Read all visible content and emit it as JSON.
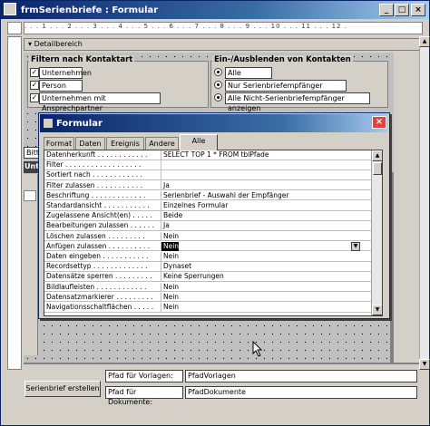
{
  "window": {
    "title": "frmSerienbriefe : Formular"
  },
  "ruler_text": ". . . 1 . . . 2 . . . 3 . . . 4 . . . 5 . . . 6 . . . 7 . . . 8 . . . 9 . . . 10 . . . 11 . . . 12 .",
  "section": {
    "label": "Detailbereich"
  },
  "filter_group": {
    "title": "Filtern nach Kontaktart",
    "items": [
      {
        "label": "Unternehmen",
        "checked": "✓"
      },
      {
        "label": "Person",
        "checked": "✓"
      },
      {
        "label": "Unternehmen mit Ansprechpartner",
        "checked": "✓"
      }
    ]
  },
  "visibility_group": {
    "title": "Ein-/Ausblenden von Kontakten",
    "options": [
      {
        "label": "Alle anzeigen"
      },
      {
        "label": "Nur Serienbriefempfänger anzeigen"
      },
      {
        "label": "Alle Nicht-Serienbriefempfänger anzeigen"
      }
    ]
  },
  "partial_labels": {
    "bitte": "Bitt",
    "unt": "Unt"
  },
  "dialog": {
    "title": "Formular",
    "tabs": [
      "Format",
      "Daten",
      "Ereignis",
      "Andere",
      "Alle"
    ],
    "properties": [
      {
        "name": "Datenherkunft . . . . . . . . . . . .",
        "value": "SELECT TOP 1 * FROM tblPfade"
      },
      {
        "name": "Filter . . . . . . . . . . . . . . . . . .",
        "value": ""
      },
      {
        "name": "Sortiert nach . . . . . . . . . . . .",
        "value": ""
      },
      {
        "name": "Filter zulassen . . . . . . . . . . .",
        "value": "Ja"
      },
      {
        "name": "Beschriftung . . . . . . . . . . . . .",
        "value": "Serienbrief - Auswahl der Empfänger"
      },
      {
        "name": "Standardansicht . . . . . . . . . . .",
        "value": "Einzelnes Formular"
      },
      {
        "name": "Zugelassene Ansicht(en) . . . . .",
        "value": "Beide"
      },
      {
        "name": "Bearbeitungen zulassen . . . . . .",
        "value": "Ja"
      },
      {
        "name": "Löschen zulassen . . . . . . . . .",
        "value": "Nein"
      },
      {
        "name": "Anfügen zulassen . . . . . . . . . .",
        "value": "Nein"
      },
      {
        "name": "Daten eingeben . . . . . . . . . . .",
        "value": "Nein"
      },
      {
        "name": "Recordsettyp . . . . . . . . . . . . .",
        "value": "Dynaset"
      },
      {
        "name": "Datensätze sperren . . . . . . . . .",
        "value": "Keine Sperrungen"
      },
      {
        "name": "Bildlaufleisten . . . . . . . . . . . .",
        "value": "Nein"
      },
      {
        "name": "Datensatzmarkierer . . . . . . . . .",
        "value": "Nein"
      },
      {
        "name": "Navigationsschaltflächen . . . . .",
        "value": "Nein"
      }
    ]
  },
  "bottom": {
    "button_label": "Serienbrief erstellen",
    "pfad_vorlagen_label": "Pfad für Vorlagen:",
    "pfad_vorlagen_value": "PfadVorlagen",
    "pfad_dokumente_label": "Pfad für Dokumente:",
    "pfad_dokumente_value": "PfadDokumente"
  }
}
